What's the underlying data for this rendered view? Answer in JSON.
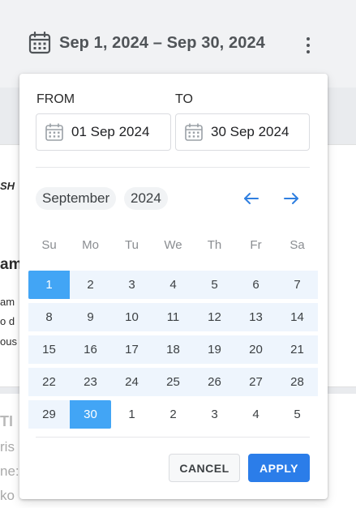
{
  "background": {
    "fragments": [
      "SH",
      "am",
      "am",
      "o d",
      "ous",
      "TI",
      "ris",
      "ne:",
      "ko"
    ]
  },
  "header": {
    "range_title": "Sep 1, 2024 – Sep 30, 2024"
  },
  "picker": {
    "from_label": "FROM",
    "to_label": "TO",
    "from_value": "01 Sep 2024",
    "to_value": "30 Sep 2024",
    "month": "September",
    "year": "2024",
    "weekdays": [
      "Su",
      "Mo",
      "Tu",
      "We",
      "Th",
      "Fr",
      "Sa"
    ],
    "weeks": [
      [
        "1",
        "2",
        "3",
        "4",
        "5",
        "6",
        "7"
      ],
      [
        "8",
        "9",
        "10",
        "11",
        "12",
        "13",
        "14"
      ],
      [
        "15",
        "16",
        "17",
        "18",
        "19",
        "20",
        "21"
      ],
      [
        "22",
        "23",
        "24",
        "25",
        "26",
        "27",
        "28"
      ],
      [
        "29",
        "30",
        "1",
        "2",
        "3",
        "4",
        "5"
      ]
    ],
    "selected_start": "1",
    "selected_end": "30",
    "cancel_label": "CANCEL",
    "apply_label": "APPLY"
  },
  "icons": {
    "calendar": "calendar-icon",
    "more": "more-vert-icon",
    "prev": "arrow-left-icon",
    "next": "arrow-right-icon"
  },
  "colors": {
    "accent": "#2b7de9",
    "selected_day": "#42a5f5",
    "range_band": "#eef5fd",
    "arrow": "#2f7fe0"
  }
}
